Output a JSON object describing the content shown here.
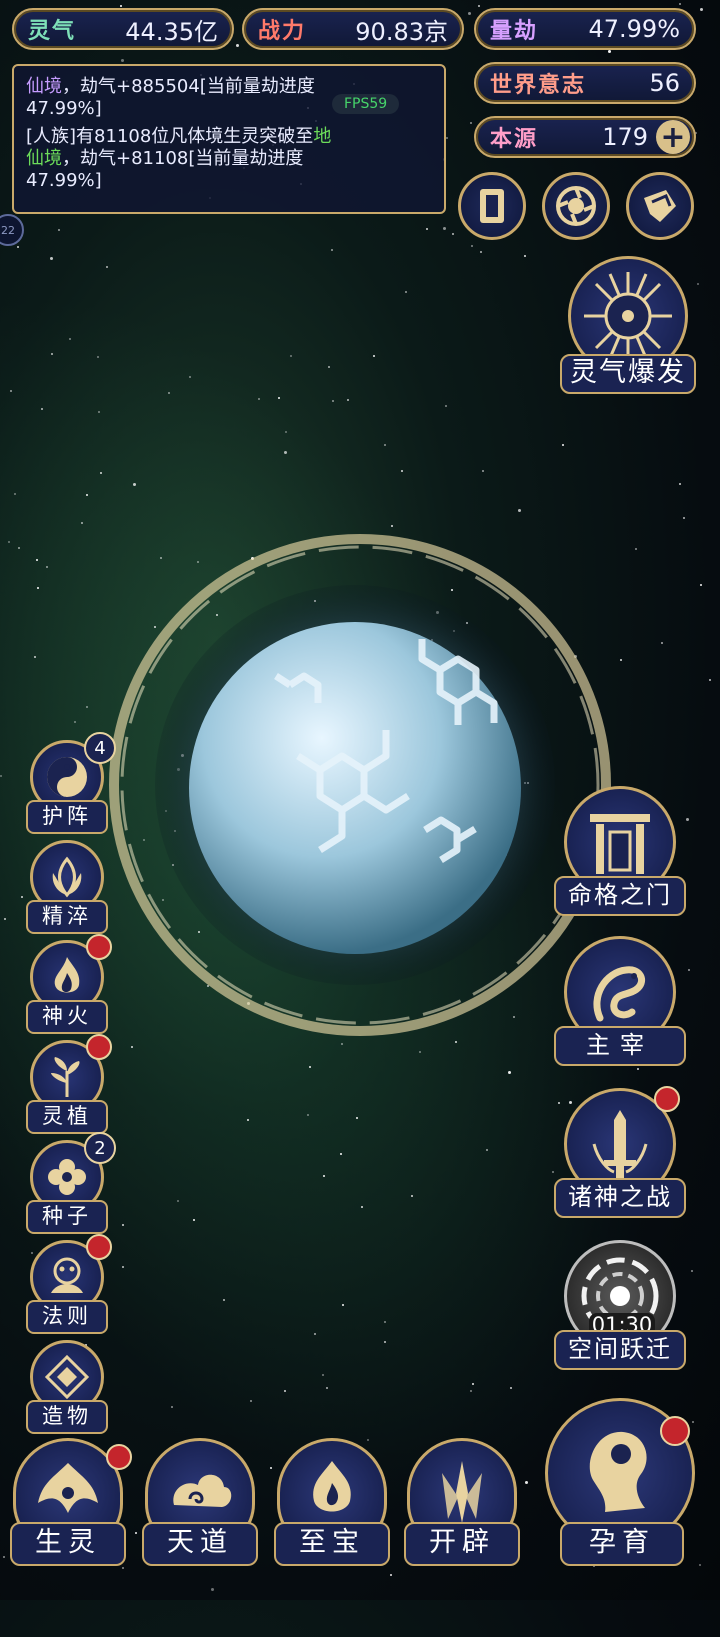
{
  "stats": {
    "lingqi": {
      "label": "灵气",
      "value": "44.35亿",
      "color": "#7ee0b8"
    },
    "zhanli": {
      "label": "战力",
      "value": "90.83京",
      "color": "#ff7a6a"
    },
    "liangjie": {
      "label": "量劫",
      "value": "47.99%",
      "color": "#d7a0ff"
    },
    "shijie": {
      "label": "世界意志",
      "value": "56",
      "color": "#ff9d8a"
    },
    "benyuan": {
      "label": "本源",
      "value": "179",
      "color": "#ff9ec8",
      "plus": "+"
    }
  },
  "log": {
    "line1_prefix": "仙境",
    "line1_rest": "，劫气+885504[当前量劫进度",
    "line2": "47.99%]",
    "line3_pre": "[人族]有81108位凡体境生灵突破至",
    "line3_hl": "地",
    "line4_hl": "仙境",
    "line4_rest": "，劫气+81108[当前量劫进度",
    "line5": "47.99%]",
    "fps": "FPS59",
    "side_tab": "22"
  },
  "top_icons": [
    "card-icon",
    "vortex-icon",
    "scroll-icon"
  ],
  "burst": {
    "label": "灵气爆发"
  },
  "left_buttons": [
    {
      "label": "护阵",
      "badge": "4"
    },
    {
      "label": "精淬"
    },
    {
      "label": "神火",
      "dot": true
    },
    {
      "label": "灵植",
      "dot": true
    },
    {
      "label": "种子",
      "badge": "2"
    },
    {
      "label": "法则",
      "dot": true
    },
    {
      "label": "造物"
    }
  ],
  "right_buttons": [
    {
      "label": "命格之门"
    },
    {
      "label": "主宰"
    },
    {
      "label": "诸神之战",
      "dot": true
    },
    {
      "label": "空间跃迁",
      "timer": "01:30"
    }
  ],
  "bottom_buttons": [
    {
      "label": "生灵",
      "dot": true
    },
    {
      "label": "天道"
    },
    {
      "label": "至宝"
    },
    {
      "label": "开辟"
    },
    {
      "label": "孕育",
      "dot": true
    }
  ]
}
